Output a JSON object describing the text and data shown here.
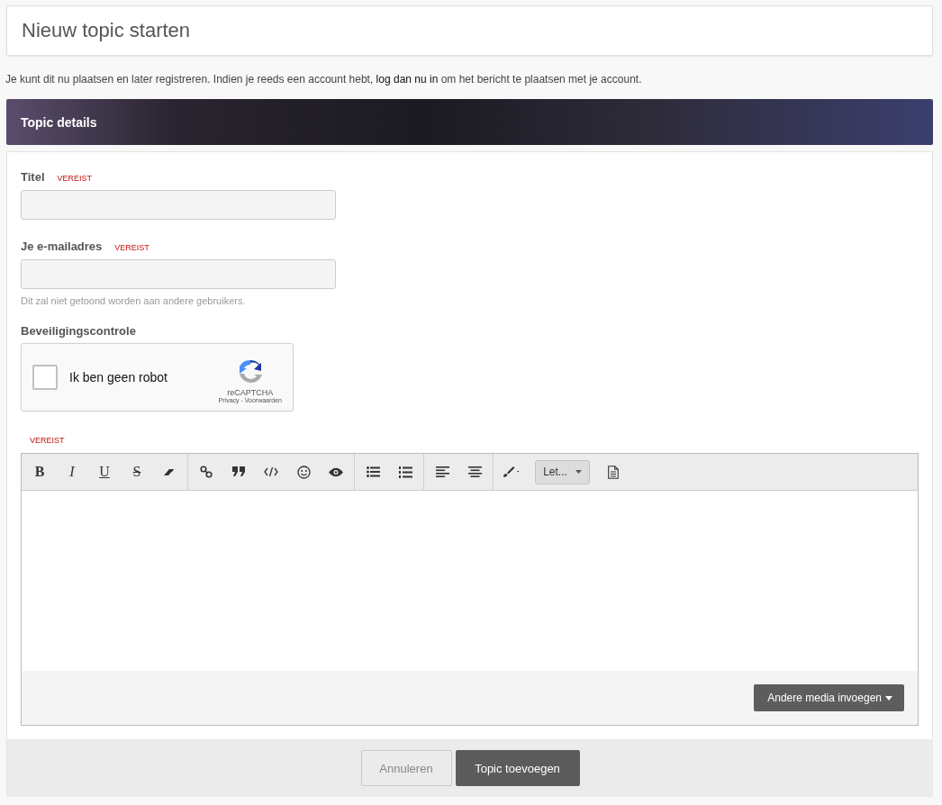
{
  "page_title": "Nieuw topic starten",
  "notice": {
    "before": "Je kunt dit nu plaatsen en later registreren. Indien je reeds een account hebt, ",
    "link": "log dan nu in",
    "after": " om het bericht te plaatsen met je account."
  },
  "section_title": "Topic details",
  "fields": [
    {
      "label": "Titel",
      "required": "VEREIST"
    },
    {
      "label": "Je e-mailadres",
      "required": "VEREIST",
      "hint": "Dit zal niet getoond worden aan andere gebruikers."
    }
  ],
  "captcha": {
    "label": "Beveiligingscontrole",
    "checkbox_text": "Ik ben geen robot",
    "checked": false,
    "brand": "reCAPTCHA",
    "links": "Privacy - Voorwaarden"
  },
  "editor": {
    "required": "VEREIST",
    "format_letters": [
      "B",
      "I",
      "U",
      "S"
    ],
    "font_dropdown": "Let...",
    "media_button": "Andere media invoegen"
  },
  "buttons": {
    "cancel": "Annuleren",
    "submit": "Topic toevoegen"
  }
}
